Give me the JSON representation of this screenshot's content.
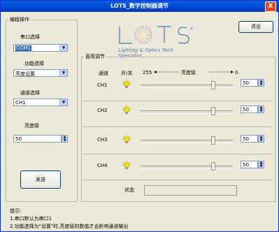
{
  "window": {
    "title": "LOTS_数字控制器调节",
    "close_label": "X"
  },
  "logo": {
    "letters": [
      "L",
      "O",
      "T",
      "S"
    ],
    "registered": "®",
    "tagline": "Lighting & Optics Tech Specialist"
  },
  "left_panel": {
    "group_title": "编程操作",
    "port_label": "串口选择",
    "port_value": "COM1",
    "function_label": "功能选择",
    "function_value": "亮度设置",
    "channel_label": "通道选择",
    "channel_value": "CH1",
    "brightness_label": "亮度级",
    "brightness_value": "50",
    "send_label": "发送"
  },
  "exit_label": "退出",
  "right_panel": {
    "group_title": "直观调节",
    "col_channel": "通道",
    "col_switch": "开/关",
    "scale_max": "255",
    "scale_label": "亮度级",
    "scale_min": "0",
    "channels": [
      {
        "name": "CH1",
        "value": "50",
        "level": 0.196
      },
      {
        "name": "CH2",
        "value": "50",
        "level": 0.196
      },
      {
        "name": "CH3",
        "value": "50",
        "level": 0.196
      },
      {
        "name": "CH4",
        "value": "50",
        "level": 0.196
      }
    ],
    "status_label": "状态",
    "status_value": ""
  },
  "hints": {
    "title": "提示:",
    "line1": "1.串口默认为串口1",
    "line2": "2.功能选择为\"设置\"时,亮度级的数值才会影响通道输出"
  },
  "colors": {
    "title_bar": "#0046d5",
    "window_bg": "#ece9d8",
    "bulb": "#f2dd10",
    "logo_blue": "#4777b9"
  }
}
